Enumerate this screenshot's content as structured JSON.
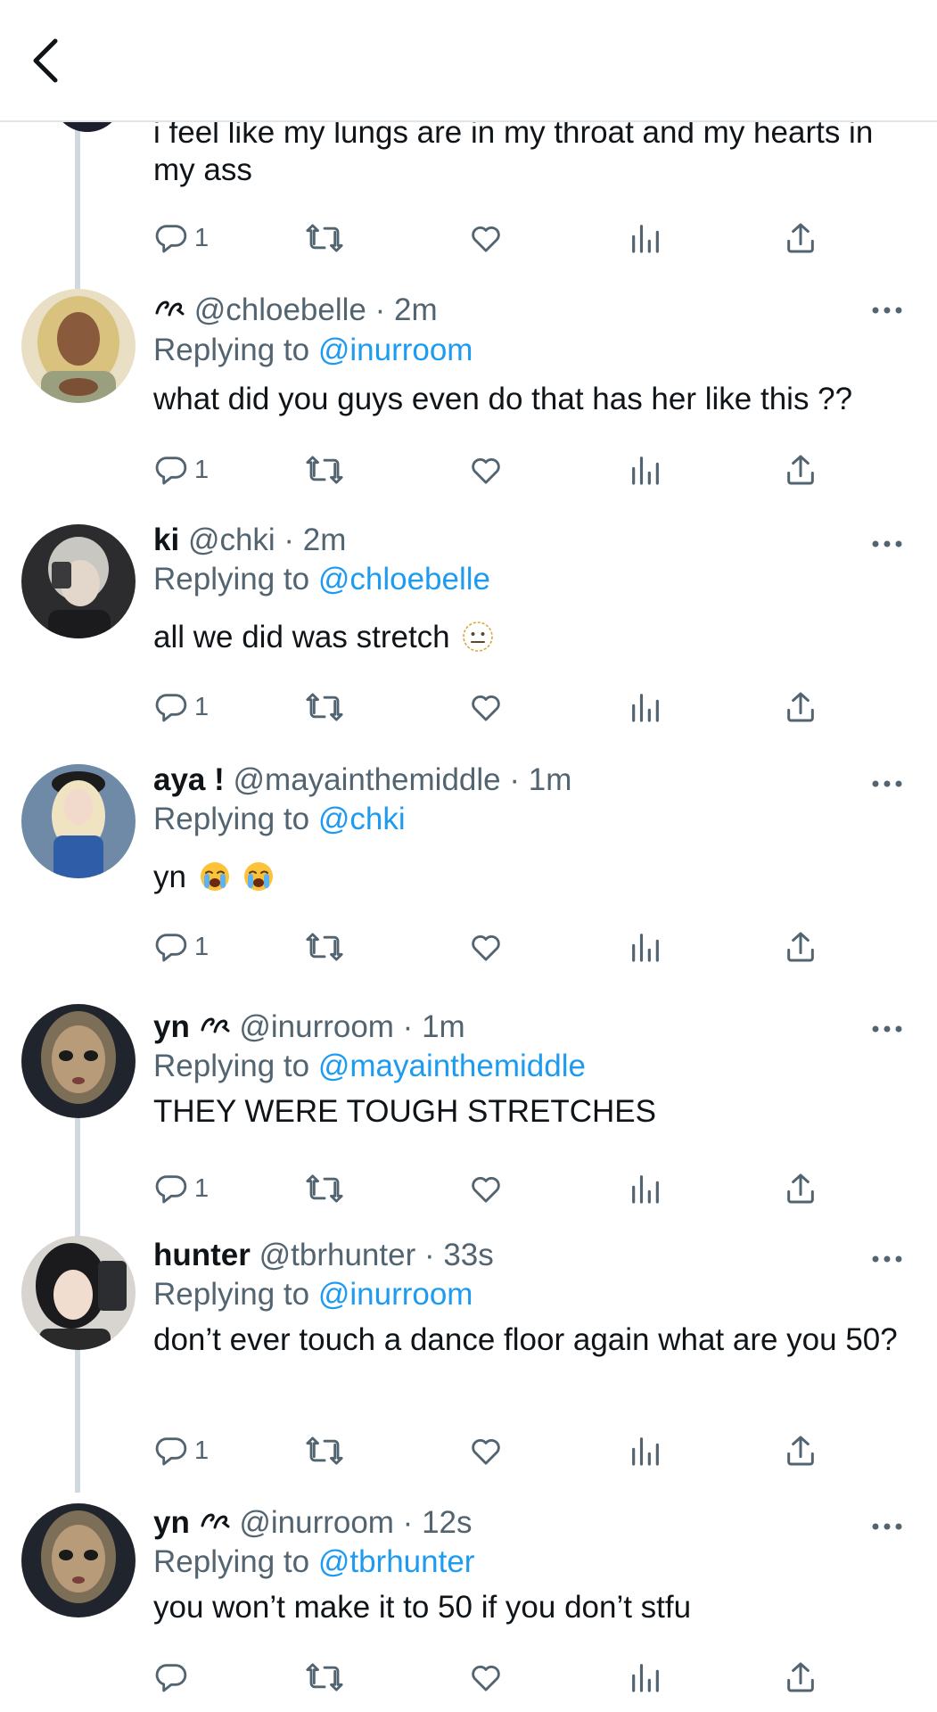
{
  "header": {
    "back_label": ""
  },
  "first_tweet": {
    "text": "i feel like my lungs are in my throat and my hearts in my ass",
    "reply_count": "1"
  },
  "tweets": [
    {
      "name": "",
      "name_symbol": "",
      "handle_time": "@chloebelle · 2m",
      "replying_prefix": "Replying to ",
      "replying_to": "@inurroom",
      "text": "what did you guys even do that has her like this ??",
      "reply_count": "1"
    },
    {
      "name": "ki",
      "handle_time": "@chki · 2m",
      "replying_prefix": "Replying to ",
      "replying_to": "@chloebelle",
      "text": "all we did was stretch",
      "emoji": [
        "neutral-face"
      ],
      "reply_count": "1"
    },
    {
      "name": "aya !",
      "handle_time": "@mayainthemiddle · 1m",
      "replying_prefix": "Replying to ",
      "replying_to": "@chki",
      "text": "yn",
      "emoji": [
        "loudly-crying-face",
        "loudly-crying-face"
      ],
      "reply_count": "1"
    },
    {
      "name": "yn",
      "handle_time": "@inurroom · 1m",
      "replying_prefix": "Replying to ",
      "replying_to": "@mayainthemiddle",
      "text": "THEY WERE TOUGH STRETCHES",
      "reply_count": "1"
    },
    {
      "name": "hunter",
      "handle_time": "@tbrhunter · 33s",
      "replying_prefix": "Replying to ",
      "replying_to": "@inurroom",
      "text": "don’t ever touch a dance floor again what are you 50?",
      "reply_count": "1"
    },
    {
      "name": "yn",
      "handle_time": "@inurroom · 12s",
      "replying_prefix": "Replying to ",
      "replying_to": "@tbrhunter",
      "text": "you won’t make it to 50 if you don’t stfu",
      "reply_count": ""
    }
  ],
  "colors": {
    "link": "#1d9bf0",
    "secondary_text": "#536471",
    "icon": "#536471",
    "thread_line": "#cfd9de"
  }
}
